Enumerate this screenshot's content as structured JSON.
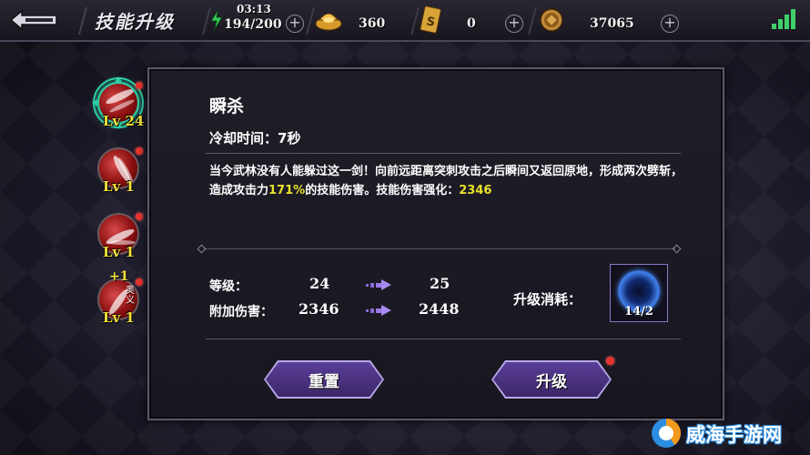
{
  "topbar": {
    "title": "技能升级",
    "energy": {
      "time": "03:13",
      "value": "194/200",
      "icon": "lightning-icon"
    },
    "ingot": {
      "value": "360",
      "icon": "gold-ingot-icon"
    },
    "card": {
      "value": "0",
      "icon": "card-icon"
    },
    "coin": {
      "value": "37065",
      "icon": "coin-icon"
    },
    "signal_icon": "signal-strength-icon"
  },
  "skills": [
    {
      "level": "Lv 24",
      "active": true,
      "has_dot": true
    },
    {
      "level": "Lv 1",
      "active": false,
      "has_dot": true
    },
    {
      "level": "Lv 1",
      "active": false,
      "has_dot": true
    },
    {
      "level": "Lv 1",
      "active": false,
      "has_dot": true,
      "plus": "+1",
      "tag": "奥\n义"
    }
  ],
  "panel": {
    "skill_name": "瞬杀",
    "cooldown": "冷却时间：7秒",
    "desc_part1": "当今武林没有人能躲过这一剑！向前远距离突刺攻击之后瞬间又返回原地，形成两次劈斩，造成攻击力",
    "desc_pct": "171%",
    "desc_part2": "的技能伤害。技能伤害强化：",
    "desc_dmg": "2346",
    "level_label": "等级：",
    "level_from": "24",
    "level_to": "25",
    "dmg_label": "附加伤害：",
    "dmg_from": "2346",
    "dmg_to": "2448",
    "cost_label": "升级消耗：",
    "item_count": "14/2",
    "reset_label": "重置",
    "upgrade_label": "升级"
  },
  "watermark": "威海手游网",
  "colors": {
    "highlight": "#e7e22c",
    "level": "#f4e23a",
    "button": "#4a3280",
    "energy": "#34d058"
  }
}
